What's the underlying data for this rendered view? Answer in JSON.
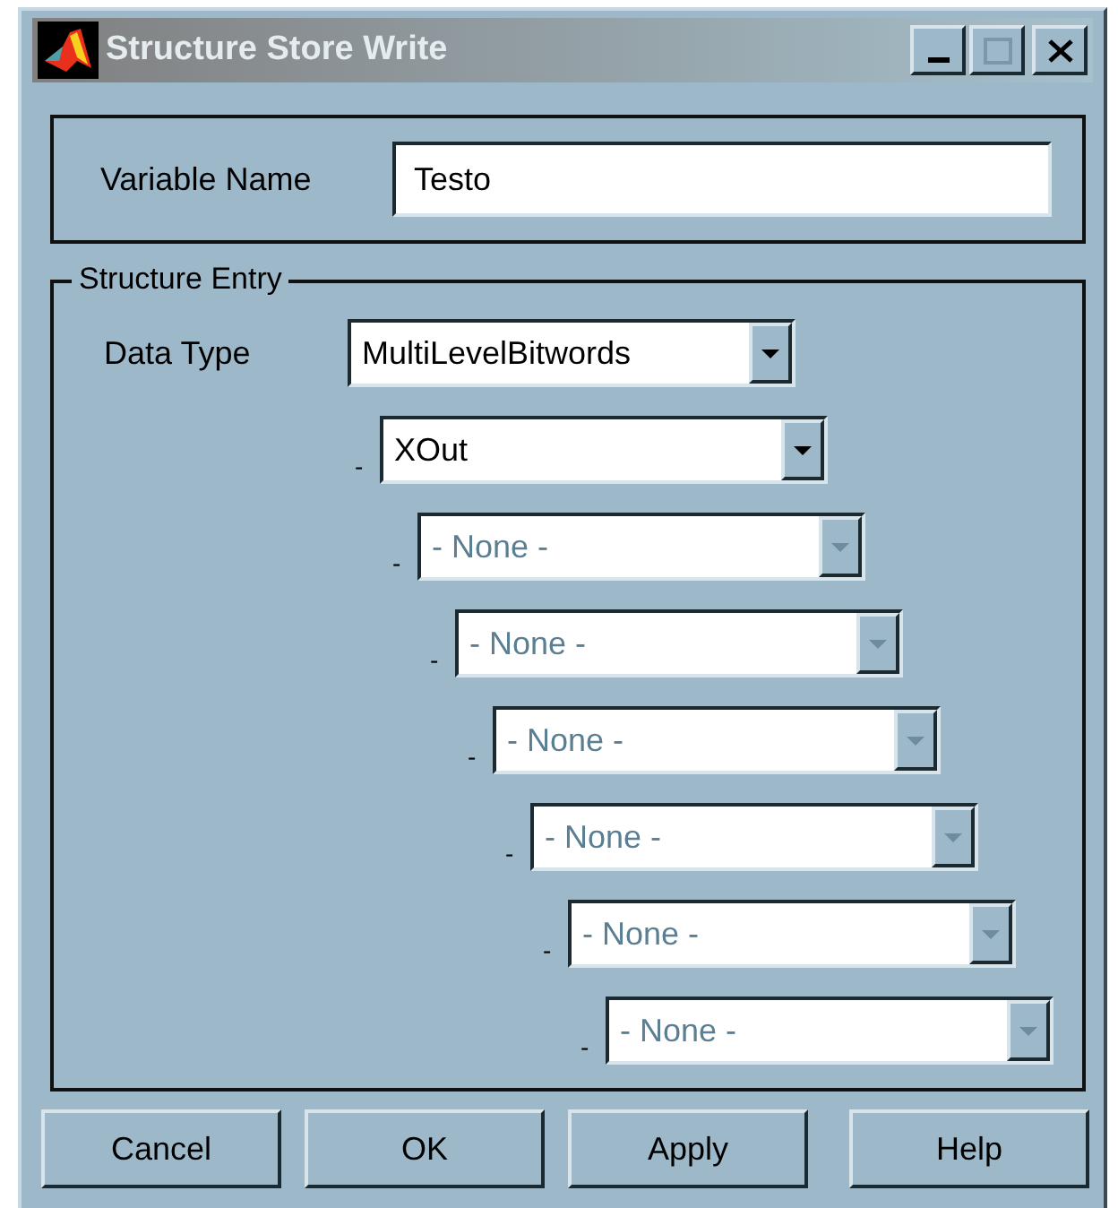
{
  "window": {
    "title": "Structure Store Write"
  },
  "variable_name": {
    "label": "Variable Name",
    "value": "Testo"
  },
  "structure_entry": {
    "title": "Structure Entry",
    "data_type": {
      "label": "Data Type",
      "value": "MultiLevelBitwords"
    },
    "levels": [
      {
        "prefix": "-",
        "value": "XOut",
        "disabled": false
      },
      {
        "prefix": "-",
        "value": "- None -",
        "disabled": true
      },
      {
        "prefix": "-",
        "value": "- None -",
        "disabled": true
      },
      {
        "prefix": "-",
        "value": "- None -",
        "disabled": true
      },
      {
        "prefix": "-",
        "value": "- None -",
        "disabled": true
      },
      {
        "prefix": "-",
        "value": "- None -",
        "disabled": true
      },
      {
        "prefix": "-",
        "value": "- None -",
        "disabled": true
      }
    ]
  },
  "buttons": [
    "Cancel",
    "OK",
    "Apply",
    "Help"
  ]
}
